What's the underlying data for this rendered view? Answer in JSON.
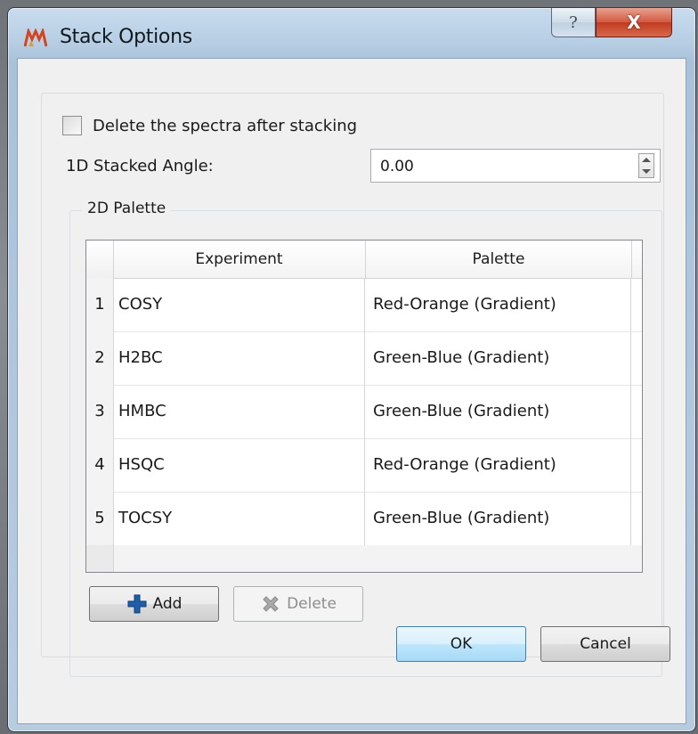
{
  "window": {
    "title": "Stack Options",
    "help_glyph": "?",
    "close_glyph": "X"
  },
  "options": {
    "delete_after_stacking_label": "Delete the spectra after stacking",
    "delete_after_stacking_checked": false,
    "angle_label": "1D Stacked Angle:",
    "angle_value": "0.00"
  },
  "palette": {
    "group_title": "2D Palette",
    "columns": [
      "Experiment",
      "Palette"
    ],
    "rows": [
      {
        "num": "1",
        "experiment": "COSY",
        "palette": "Red-Orange (Gradient)"
      },
      {
        "num": "2",
        "experiment": "H2BC",
        "palette": "Green-Blue (Gradient)"
      },
      {
        "num": "3",
        "experiment": "HMBC",
        "palette": "Green-Blue (Gradient)"
      },
      {
        "num": "4",
        "experiment": "HSQC",
        "palette": "Red-Orange (Gradient)"
      },
      {
        "num": "5",
        "experiment": "TOCSY",
        "palette": "Green-Blue (Gradient)"
      }
    ],
    "add_label": "Add",
    "delete_label": "Delete"
  },
  "footer": {
    "ok_label": "OK",
    "cancel_label": "Cancel"
  },
  "icons": {
    "app": "mnova-app-icon",
    "add": "plus-icon",
    "delete": "x-cross-icon"
  },
  "colors": {
    "add_icon": "#1f5fa8",
    "close_button": "#c9452a"
  }
}
